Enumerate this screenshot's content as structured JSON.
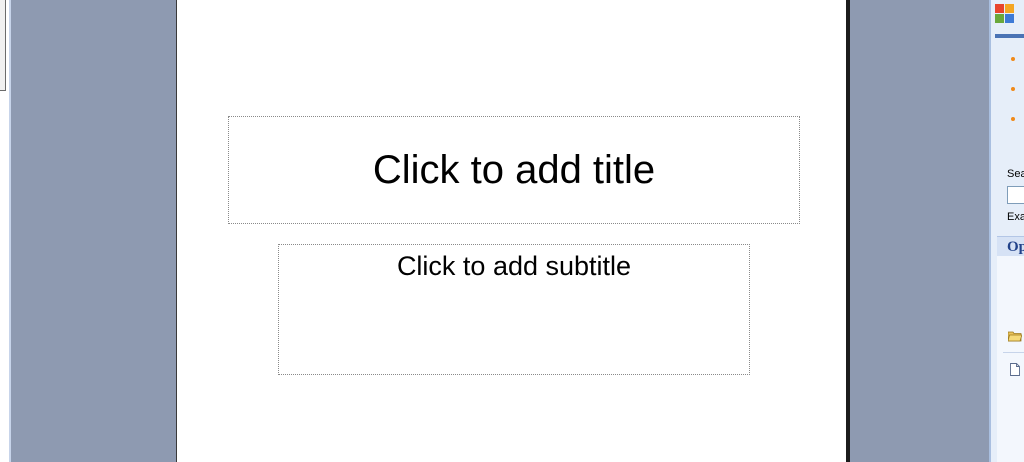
{
  "slide": {
    "title_placeholder": "Click to add title",
    "subtitle_placeholder": "Click to add subtitle"
  },
  "task_pane": {
    "search_label": "Sea",
    "example_label": "Exa",
    "open_section": "Op",
    "icons": [
      "office-logo-icon",
      "folder-open-icon",
      "new-document-icon"
    ]
  },
  "colors": {
    "workspace_bg": "#8e9ab1",
    "slide_bg": "#ffffff",
    "pane_accent": "#4a73b5",
    "bullet_orange": "#f08a1a"
  }
}
